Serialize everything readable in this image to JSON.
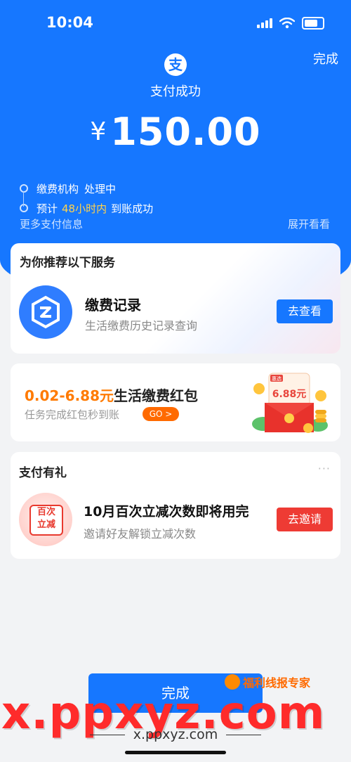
{
  "status_bar": {
    "time": "10:04"
  },
  "header": {
    "done_label": "完成",
    "logo_char": "支",
    "status_text": "支付成功",
    "currency": "¥",
    "amount": "150.00"
  },
  "timeline": {
    "step1_a": "缴费机构",
    "step1_b": "处理中",
    "step2_a": "预计",
    "step2_hl": "48小时内",
    "step2_b": "到账成功"
  },
  "more_info": "更多支付信息",
  "expand": "展开看看",
  "recommend": {
    "title": "为你推荐以下服务",
    "service_name": "缴费记录",
    "service_desc": "生活缴费历史记录查询",
    "button": "去查看"
  },
  "red_packet": {
    "amount_range": "0.02-6.88元",
    "title_rest": "生活缴费红包",
    "subtitle": "任务完成红包秒到账",
    "go_label": "GO >",
    "art_value": "6.88元",
    "art_tag": "惠选"
  },
  "gift": {
    "title": "支付有礼",
    "more": "···",
    "badge_line1": "百次",
    "badge_line2": "立减",
    "name": "10月百次立减次数即将用完",
    "desc": "邀请好友解锁立减次数",
    "button": "去邀请"
  },
  "bottom": {
    "done_label": "完成"
  },
  "watermark": {
    "big": "x.ppxyz.com",
    "badge": "福利线报专家",
    "small": "x.ppxyz.com"
  },
  "colors": {
    "brand_blue": "#1677ff",
    "highlight_yellow": "#ffd24d",
    "accent_orange": "#ff7a00",
    "action_red": "#ee3b34"
  }
}
